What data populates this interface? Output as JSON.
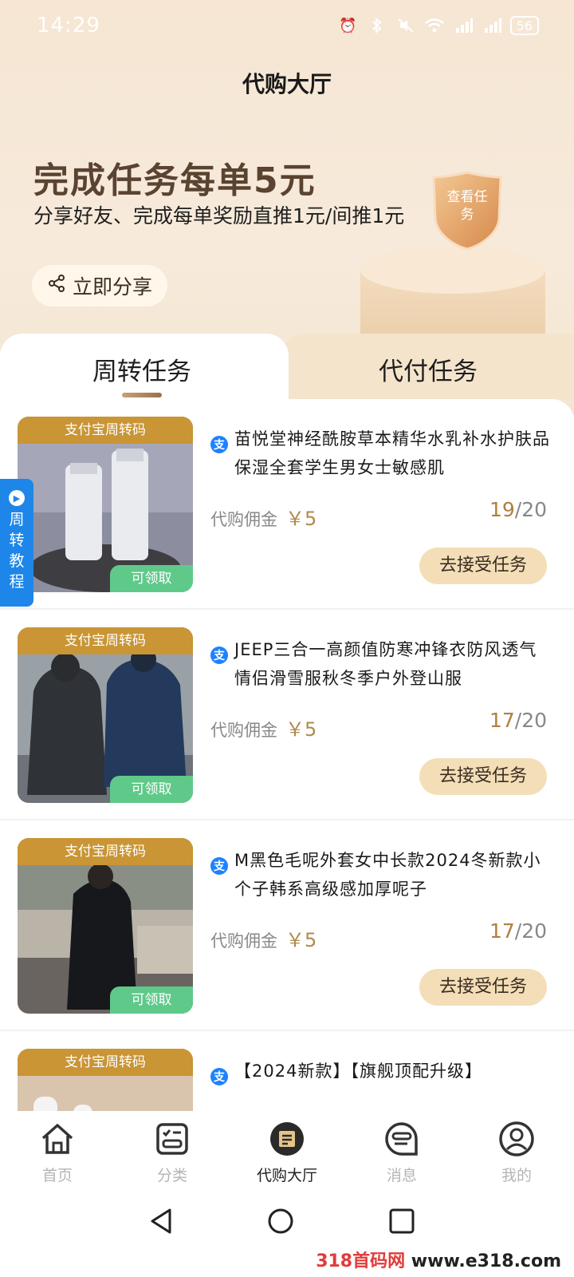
{
  "status_bar": {
    "time": "14:29",
    "battery": "56"
  },
  "header": {
    "title": "代购大厅"
  },
  "hero": {
    "title": "完成任务每单5元",
    "subtitle": "分享好友、完成每单奖励直推1元/间推1元",
    "share_label": "立即分享",
    "badge_text": "查看任务"
  },
  "tabs": [
    {
      "label": "周转任务",
      "active": true
    },
    {
      "label": "代付任务",
      "active": false
    }
  ],
  "side_tutorial": {
    "label": "周转教程"
  },
  "items": [
    {
      "tag": "支付宝周转码",
      "claim": "可领取",
      "title": "苗悦堂神经酰胺草本精华水乳补水护肤品保湿全套学生男女士敏感肌",
      "commission_label": "代购佣金",
      "commission": "￥5",
      "done": "19",
      "total": "/20",
      "accept_label": "去接受任务",
      "thumb_kind": "skincare"
    },
    {
      "tag": "支付宝周转码",
      "claim": "可领取",
      "title": "JEEP三合一高颜值防寒冲锋衣防风透气情侣滑雪服秋冬季户外登山服",
      "commission_label": "代购佣金",
      "commission": "￥5",
      "done": "17",
      "total": "/20",
      "accept_label": "去接受任务",
      "thumb_kind": "jacket"
    },
    {
      "tag": "支付宝周转码",
      "claim": "可领取",
      "title": "M黑色毛呢外套女中长款2024冬新款小个子韩系高级感加厚呢子",
      "commission_label": "代购佣金",
      "commission": "￥5",
      "done": "17",
      "total": "/20",
      "accept_label": "去接受任务",
      "thumb_kind": "coat"
    },
    {
      "tag": "支付宝周转码",
      "title": "【2024新款】【旗舰顶配升级】",
      "thumb_kind": "earbuds"
    }
  ],
  "bottom_nav": [
    {
      "label": "首页",
      "icon": "home-icon",
      "active": false
    },
    {
      "label": "分类",
      "icon": "category-icon",
      "active": false
    },
    {
      "label": "代购大厅",
      "icon": "purchase-hall-icon",
      "active": true
    },
    {
      "label": "消息",
      "icon": "message-icon",
      "active": false
    },
    {
      "label": "我的",
      "icon": "profile-icon",
      "active": false
    }
  ],
  "watermark": {
    "left": "318首码网",
    "right": "www.e318.com"
  },
  "colors": {
    "accent_gold": "#c99535",
    "claim_green": "#5fc98a",
    "button_bg": "#f4deb8",
    "alipay_blue": "#1e82ff",
    "tutorial_blue": "#1e86e8"
  }
}
